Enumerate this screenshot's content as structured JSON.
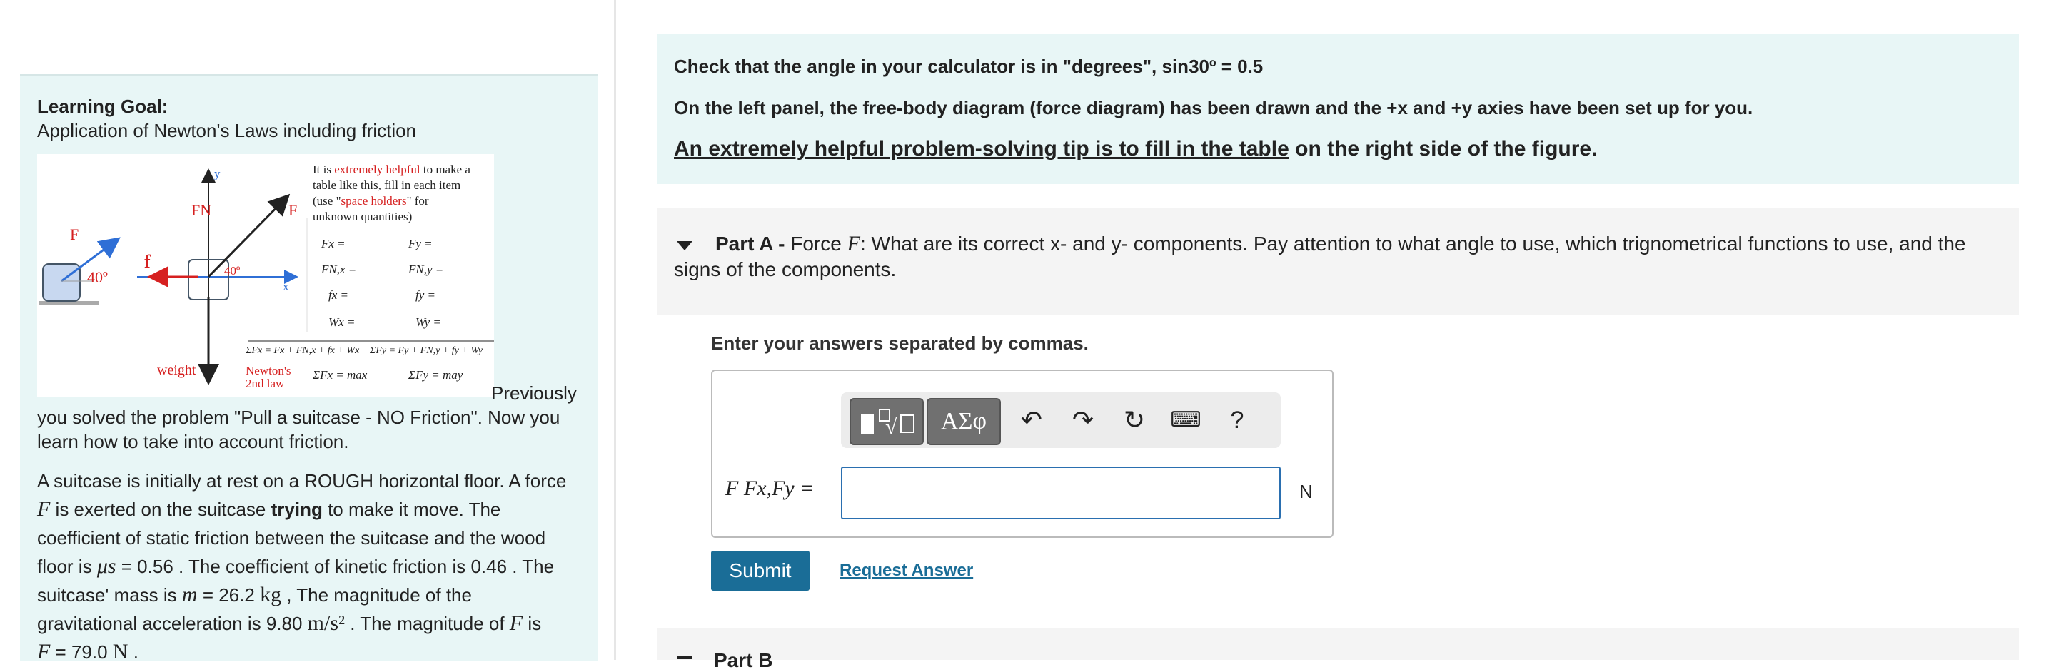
{
  "left": {
    "goal_title": "Learning Goal:",
    "goal_desc": "Application of Newton's Laws including friction",
    "figure": {
      "y_axis": "y",
      "x_axis": "x",
      "f_left": "F",
      "f_small": "f",
      "angle": "40º",
      "angle2": "40º",
      "fn": "FN",
      "f_right": "F",
      "weight": "weight",
      "tip_1": "It is ",
      "tip_red": "extremely helpful",
      "tip_2": " to make a",
      "tip_3": "table like this, fill in each item",
      "tip_4a": "(use \"",
      "tip_4red": "space holders",
      "tip_4b": "\" for",
      "tip_5": "unknown quantities)",
      "row1a": "Fx =",
      "row1b": "Fy =",
      "row2a": "FN,x =",
      "row2b": "FN,y =",
      "row3a": "fx =",
      "row3b": "fy =",
      "row4a": "Wx =",
      "row4b": "Wy =",
      "sum_x": "ΣFx = Fx + FN,x + fx + Wx",
      "sum_y": "ΣFy = Fy + FN,y + fy + Wy",
      "newton_1": "Newton's",
      "newton_2": "2nd law",
      "newton_x": "ΣFx = max",
      "newton_y": "ΣFy = may"
    },
    "previously": "Previously",
    "intro_cont": "you solved the problem \"Pull a suitcase - NO Friction\". Now you learn how to take into account friction.",
    "problem": {
      "p1": "A suitcase is initially at rest on a ROUGH horizontal floor. A force",
      "p2a": "F",
      "p2b": " is exerted on the suitcase ",
      "p2bold": "trying",
      "p2c": " to make it move. The",
      "p3": "coefficient of static friction between the suitcase and the wood",
      "p4a": "floor is ",
      "mu_s": "μs",
      "p4b": " = 0.56 . The coefficient of kinetic friction is 0.46 . The",
      "p5a": "suitcase' mass is ",
      "m": "m",
      "p5b": " = 26.2 ",
      "kg": "kg",
      "p5c": " , The magnitude of the",
      "p6a": "gravitational acceleration is 9.80 ",
      "ms2": "m/s²",
      "p6b": " . The magnitude of ",
      "F_vec": "F",
      "p6c": " is",
      "F_sym": "F",
      "p7b": " = 79.0 ",
      "N": "N",
      "p7c": " ."
    }
  },
  "info": {
    "line1": "Check that the angle in your calculator is in \"degrees\", sin30º = 0.5",
    "line2": "On the left panel, the free-body diagram (force diagram) has been drawn  and the +x and +y axies have been set up for you.",
    "line3_u": "An extremely helpful problem-solving tip is to fill in the table",
    "line3_rest": " on the right side of the figure."
  },
  "partA": {
    "label": "Part A -",
    "text_a": " Force ",
    "F": "F",
    "text_b": ": What are its correct x- and y- components. Pay attention to what angle to use, which trignometrical functions to use, and the signs of the components."
  },
  "answer": {
    "instruction": "Enter your answers separated by commas.",
    "label": "F Fx,Fy =",
    "value": "",
    "unit": "N",
    "toolbar": {
      "greek": "ΑΣφ",
      "undo": "↶",
      "redo": "↷",
      "reset": "↻",
      "keyboard": "⌨",
      "help": "?"
    },
    "submit": "Submit",
    "request": "Request Answer"
  },
  "partB": {
    "label": "Part B"
  }
}
